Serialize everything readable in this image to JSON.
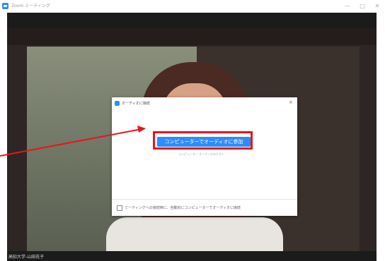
{
  "window": {
    "title": "Zoom ミーティング",
    "minimize": "—",
    "maximize": "□",
    "close": "✕"
  },
  "video": {
    "participant_name": "高知大学-山田花子"
  },
  "dialog": {
    "title": "オーディオに接続",
    "close": "×",
    "join_button": "コンピューターでオーディオに参加",
    "test_link": "コンピューター オーディオのテスト",
    "auto_join_label": "ミーティングへの接続時に、自動的にコンピューターでオーディオに接続",
    "auto_join_checked": false
  },
  "annotation": {
    "color": "#e8151c"
  }
}
